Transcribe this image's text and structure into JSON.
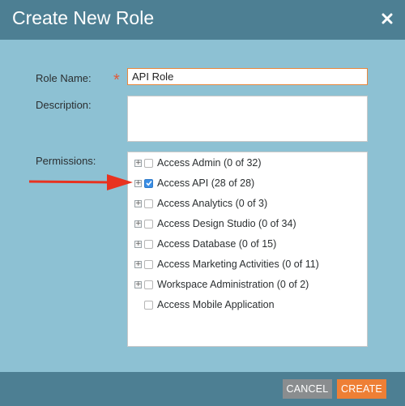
{
  "dialog": {
    "title": "Create New Role",
    "close_icon": "close-icon"
  },
  "form": {
    "role_name_label": "Role Name:",
    "role_name_value": "API Role",
    "required_marker": "*",
    "description_label": "Description:",
    "description_value": "",
    "permissions_label": "Permissions:"
  },
  "permissions": [
    {
      "label": "Access Admin (0 of 32)",
      "checked": false,
      "expandable": true
    },
    {
      "label": "Access API (28 of 28)",
      "checked": true,
      "expandable": true
    },
    {
      "label": "Access Analytics (0 of 3)",
      "checked": false,
      "expandable": true
    },
    {
      "label": "Access Design Studio (0 of 34)",
      "checked": false,
      "expandable": true
    },
    {
      "label": "Access Database (0 of 15)",
      "checked": false,
      "expandable": true
    },
    {
      "label": "Access Marketing Activities (0 of 11)",
      "checked": false,
      "expandable": true
    },
    {
      "label": "Workspace Administration (0 of 2)",
      "checked": false,
      "expandable": true
    },
    {
      "label": "Access Mobile Application",
      "checked": false,
      "expandable": false
    }
  ],
  "footer": {
    "cancel_label": "CANCEL",
    "create_label": "CREATE"
  },
  "colors": {
    "header_bg": "#4d7f93",
    "body_bg": "#8dc1d3",
    "accent_orange": "#ee7f35",
    "annotation_arrow": "#e8321f"
  }
}
